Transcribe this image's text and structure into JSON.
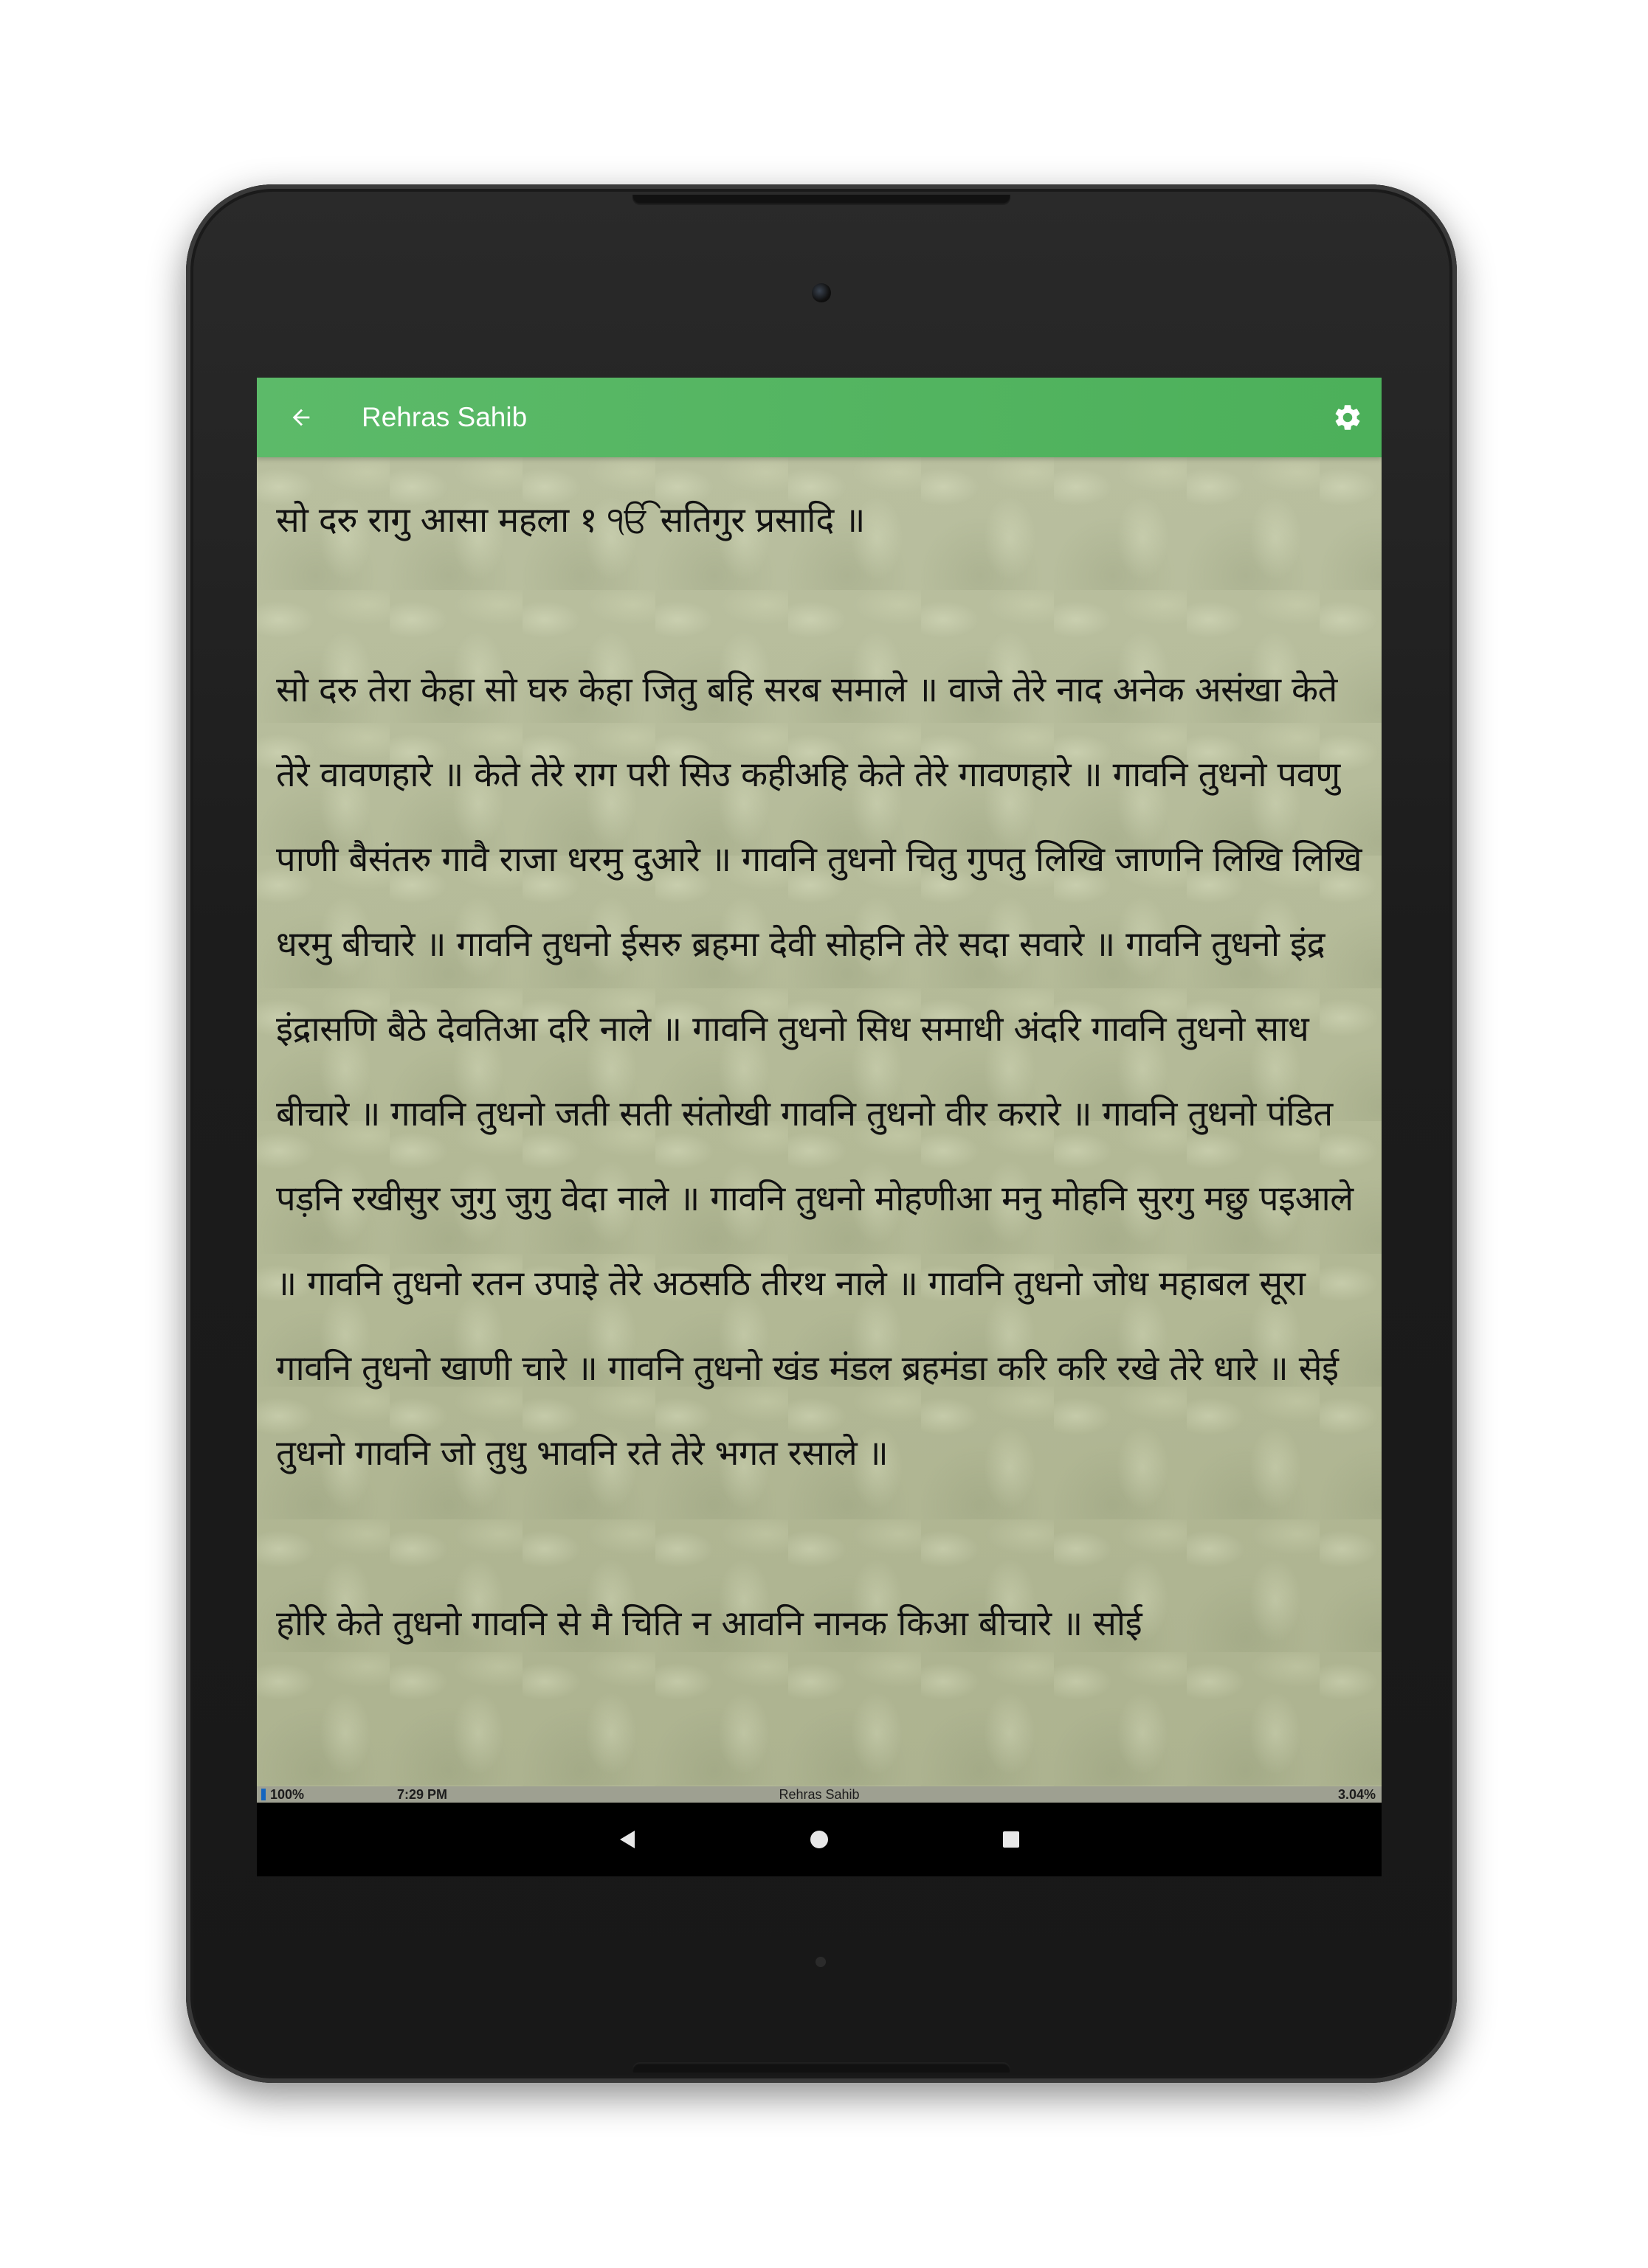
{
  "app_bar": {
    "title": "Rehras Sahib",
    "back_icon": "arrow-left-icon",
    "settings_icon": "gear-icon",
    "color": "#53b560"
  },
  "content": {
    "paragraphs": [
      "सो दरु रागु आसा महला १ ੴ सतिगुर प्रसादि ॥",
      "सो दरु तेरा केहा सो घरु केहा जितु बहि सरब समाले ॥ वाजे तेरे नाद अनेक असंखा केते तेरे वावणहारे ॥ केते तेरे राग परी सिउ कहीअहि केते तेरे गावणहारे ॥ गावनि तुधनो पवणु पाणी बैसंतरु गावै राजा धरमु दुआरे ॥ गावनि तुधनो चितु गुपतु लिखि जाणनि लिखि लिखि धरमु बीचारे ॥ गावनि तुधनो ईसरु ब्रहमा देवी सोहनि तेरे सदा सवारे ॥ गावनि तुधनो इंद्र इंद्रासणि बैठे देवतिआ दरि नाले ॥ गावनि तुधनो सिध समाधी अंदरि गावनि तुधनो साध बीचारे ॥ गावनि तुधनो जती सती संतोखी गावनि तुधनो वीर करारे ॥ गावनि तुधनो पंडित पड़नि रखीसुर जुगु जुगु वेदा नाले ॥ गावनि तुधनो मोहणीआ मनु मोहनि सुरगु मछु पइआले ॥  गावनि तुधनो रतन उपाइे तेरे अठसठि तीरथ नाले ॥ गावनि तुधनो जोध महाबल सूरा गावनि तुधनो खाणी चारे ॥ गावनि तुधनो खंड मंडल ब्रहमंडा करि करि रखे तेरे धारे ॥ सेई तुधनो गावनि जो तुधु भावनि रते तेरे भगत रसाले ॥",
      "होरि केते तुधनो गावनि से मै चिति न आवनि नानक किआ बीचारे ॥  सोई"
    ]
  },
  "status_bar": {
    "battery": "100%",
    "time": "7:29 PM",
    "title": "Rehras Sahib",
    "progress": "3.04%"
  },
  "nav_bar": {
    "back_icon": "triangle-back-icon",
    "home_icon": "circle-home-icon",
    "recents_icon": "square-recents-icon"
  }
}
